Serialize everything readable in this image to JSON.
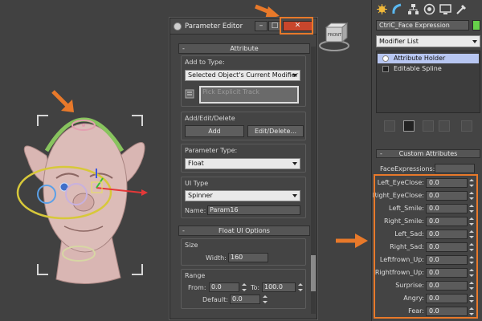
{
  "viewport": {
    "icons": [
      "front-view-cube",
      "face-model",
      "orange-arrow"
    ]
  },
  "param_editor": {
    "title": "Parameter Editor",
    "close_symbol": "✕",
    "minimize_symbol": "–",
    "maximize_symbol": "□",
    "attribute": {
      "header": "Attribute",
      "collapse_symbol": "-",
      "add_to_type_label": "Add to Type:",
      "add_to_type_value": "Selected Object's Current Modifier",
      "pick_explicit_track": "Pick Explicit Track",
      "add_edit_delete_label": "Add/Edit/Delete",
      "add_button": "Add",
      "edit_delete_button": "Edit/Delete...",
      "parameter_type_label": "Parameter Type:",
      "parameter_type_value": "Float",
      "ui_type_label": "UI Type",
      "ui_type_value": "Spinner",
      "name_label": "Name:",
      "name_value": "Param16"
    },
    "float_ui": {
      "header": "Float UI Options",
      "collapse_symbol": "-",
      "size_label": "Size",
      "width_label": "Width:",
      "width_value": "160",
      "range_label": "Range",
      "from_label": "From:",
      "from_value": "0.0",
      "to_label": "To:",
      "to_value": "100.0",
      "default_label": "Default:",
      "default_value": "0.0"
    }
  },
  "command_panel": {
    "object_name": "CtrlC_Face Expression",
    "object_color": "#66d04a",
    "modifier_list": "Modifier List",
    "stack": [
      {
        "label": "Attribute Holder",
        "selected": true
      },
      {
        "label": "Editable Spline",
        "selected": false
      }
    ],
    "custom_attributes": {
      "header": "Custom Attributes",
      "collapse_symbol": "-",
      "face_expressions_label": "FaceExpressions:",
      "rows": [
        {
          "label": "Left_EyeClose:",
          "value": "0.0"
        },
        {
          "label": "Right_EyeClose:",
          "value": "0.0"
        },
        {
          "label": "Left_Smile:",
          "value": "0.0"
        },
        {
          "label": "Right_Smile:",
          "value": "0.0"
        },
        {
          "label": "Left_Sad:",
          "value": "0.0"
        },
        {
          "label": "Right_Sad:",
          "value": "0.0"
        },
        {
          "label": "Leftfrown_Up:",
          "value": "0.0"
        },
        {
          "label": "Rightfrown_Up:",
          "value": "0.0"
        },
        {
          "label": "Surprise:",
          "value": "0.0"
        },
        {
          "label": "Angry:",
          "value": "0.0"
        },
        {
          "label": "Fear:",
          "value": "0.0"
        }
      ]
    }
  },
  "highlight_color": "#e8792a"
}
